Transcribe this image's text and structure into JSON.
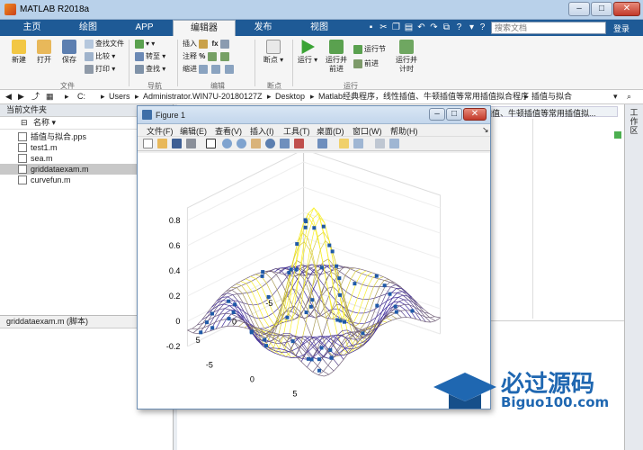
{
  "app": {
    "title": "MATLAB R2018a",
    "window_buttons": [
      "–",
      "□",
      "✕"
    ]
  },
  "tabs": [
    "主页",
    "绘图",
    "APP",
    "编辑器",
    "发布",
    "视图"
  ],
  "search_placeholder": "搜索文档",
  "signin": "登录",
  "ribbon": {
    "file": {
      "new": "新建",
      "open": "打开",
      "save": "保存",
      "find_files": "查找文件",
      "compare": "比较",
      "print": "打印",
      "group": "文件"
    },
    "navigate": {
      "goto": "转至",
      "find": "查找",
      "group": "导航"
    },
    "edit": {
      "insert": "插入",
      "comment": "注释",
      "indent": "缩进",
      "group": "编辑"
    },
    "breakpoints": {
      "label": "断点",
      "group": "断点"
    },
    "run": {
      "run": "运行",
      "run_advance": "运行并\n前进",
      "run_section": "运行节",
      "advance": "前进",
      "run_time": "运行并\n计时",
      "group": "运行"
    }
  },
  "path": [
    "C:",
    "Users",
    "Administrator.WIN7U-20180127Z",
    "Desktop",
    "Matlab经典程序，线性插值、牛顿插值等常用插值拟合程序",
    "插值与拟合"
  ],
  "left_pane": {
    "title": "当前文件夹",
    "column": "名称",
    "files": [
      "插值与拟合.pps",
      "test1.m",
      "sea.m",
      "griddataexam.m",
      "curvefun.m"
    ],
    "selected": 3,
    "details_title": "griddataexam.m  (脚本)"
  },
  "editor_tab_text": "插值、牛顿插值等常用插值拟...",
  "side_label": "工作区",
  "figure": {
    "title": "Figure 1",
    "menus": [
      "文件(F)",
      "编辑(E)",
      "查看(V)",
      "插入(I)",
      "工具(T)",
      "桌面(D)",
      "窗口(W)",
      "帮助(H)"
    ]
  },
  "chart_data": {
    "type": "surface",
    "zlabel_ticks": [
      "0.8",
      "0.6",
      "0.4",
      "0.2",
      "0",
      "-0.2"
    ],
    "x_ticks": [
      "-5",
      "0",
      "5"
    ],
    "y_ticks": [
      "5",
      "0",
      "-5"
    ],
    "z_range": [
      -0.2,
      0.8
    ],
    "x_range": [
      -8,
      8
    ],
    "y_range": [
      -8,
      8
    ]
  },
  "watermark": {
    "brand": "必过源码",
    "url": "Biguo100.com"
  }
}
